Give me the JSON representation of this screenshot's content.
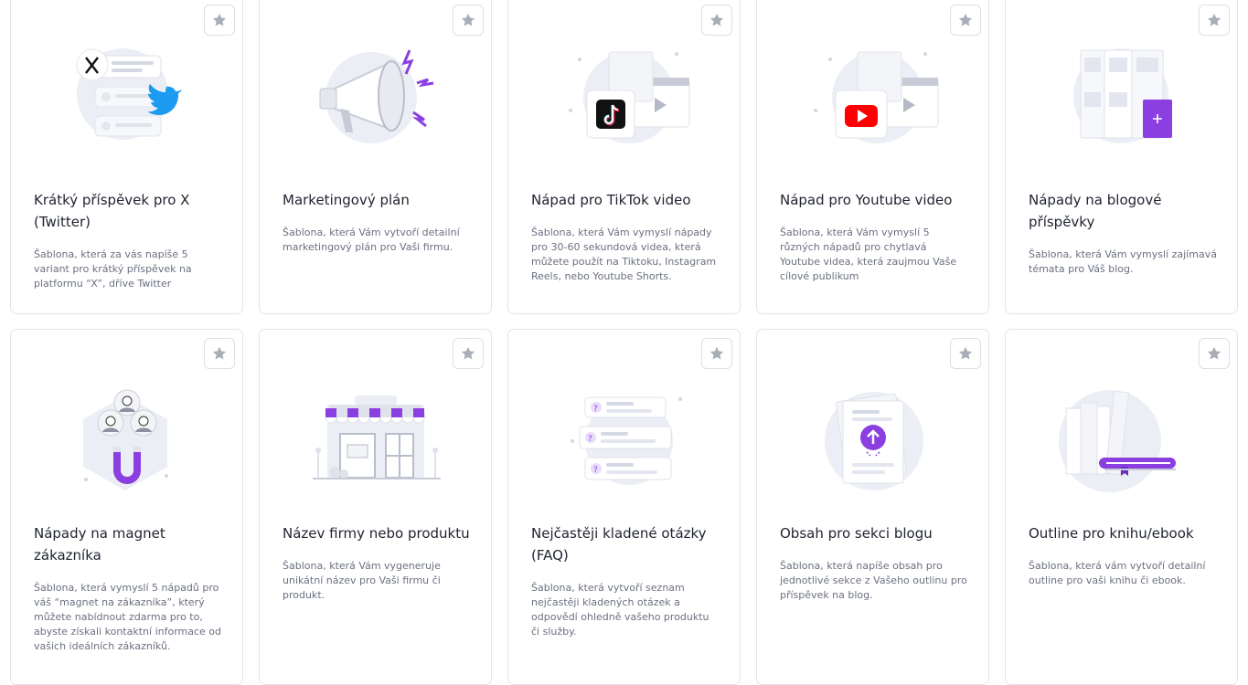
{
  "colors": {
    "accent": "#8b3fe0",
    "star": "#a9adb8",
    "border": "#e3e5ea"
  },
  "cards": [
    {
      "title": "Krátký příspěvek pro X (Twitter)",
      "description": "Šablona, která za vás napíše 5 variant pro krátký příspěvek na platformu “X”, dříve Twitter",
      "icon": "x-twitter-illustration"
    },
    {
      "title": "Marketingový plán",
      "description": "Šablona, která Vám vytvoří detailní marketingový plán pro Vaši firmu.",
      "icon": "megaphone-illustration"
    },
    {
      "title": "Nápad pro TikTok video",
      "description": "Šablona, která Vám vymyslí nápady pro 30-60 sekundová videa, která můžete použít na Tiktoku, Instagram Reels, nebo Youtube Shorts.",
      "icon": "tiktok-video-illustration"
    },
    {
      "title": "Nápad pro Youtube video",
      "description": "Šablona, která Vám vymyslí 5 různých nápadů pro chytlavá Youtube videa, která zaujmou Vaše cílové publikum",
      "icon": "youtube-video-illustration"
    },
    {
      "title": "Nápady na blogové příspěvky",
      "description": "Šablona, která Vám vymyslí zajímavá témata pro Váš blog.",
      "icon": "blog-posts-illustration"
    },
    {
      "title": "Nápady na magnet zákazníka",
      "description": "Šablona, která vymyslí 5 nápadů pro váš “magnet na zákazníka”, který můžete nabídnout zdarma pro to, abyste získali kontaktní informace od vašich ideálních zákazníků.",
      "icon": "customer-magnet-illustration"
    },
    {
      "title": "Název firmy nebo produktu",
      "description": "Šablona, která Vám vygeneruje unikátní název pro Vaši firmu či produkt.",
      "icon": "shop-illustration"
    },
    {
      "title": "Nejčastěji kladené otázky (FAQ)",
      "description": "Šablona, která vytvoří seznam nejčastěji kladených otázek a odpovědí ohledně vašeho produktu či služby.",
      "icon": "faq-illustration"
    },
    {
      "title": "Obsah pro sekci blogu",
      "description": "Šablona, která napíše obsah pro jednotlivé sekce z Vašeho outlinu pro příspěvek na blog.",
      "icon": "blog-section-upload-illustration"
    },
    {
      "title": "Outline pro knihu/ebook",
      "description": "Šablona, která vám vytvoří detailní outline pro vaši knihu či ebook.",
      "icon": "book-illustration"
    }
  ]
}
